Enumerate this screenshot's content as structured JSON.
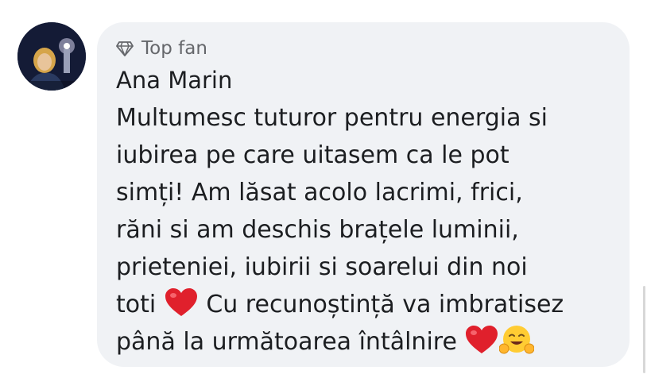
{
  "comment": {
    "badge_label": "Top fan",
    "badge_icon": "diamond-icon",
    "author": "Ana Marin",
    "lines": [
      "Multumesc tuturor pentru energia si",
      "iubirea pe care uitasem ca le pot",
      "simți! Am lăsat acolo lacrimi, frici,",
      "răni si am deschis brațele luminii,",
      "prieteniei, iubirii si soarelui din noi",
      "toti",
      "Cu recunoștință va imbratisez",
      "până la următoarea întâlnire"
    ],
    "emojis": [
      "red-heart-emoji",
      "red-heart-emoji",
      "hugging-face-emoji"
    ]
  },
  "colors": {
    "bubble_bg": "#f0f2f5",
    "text": "#1c1e21",
    "secondary_text": "#65676b",
    "heart": "#e0202c"
  }
}
